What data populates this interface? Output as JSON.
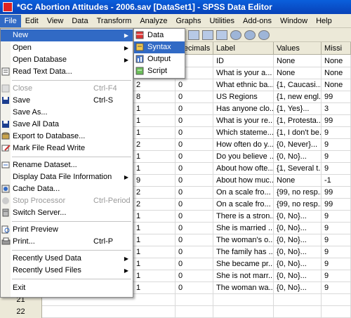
{
  "window": {
    "title": "*GC Abortion Attitudes - 2006.sav [DataSet1] - SPSS Data Editor"
  },
  "menubar": [
    "File",
    "Edit",
    "View",
    "Data",
    "Transform",
    "Analyze",
    "Graphs",
    "Utilities",
    "Add-ons",
    "Window",
    "Help"
  ],
  "columns": {
    "decimals": "Decimals",
    "label": "Label",
    "values": "Values",
    "missing": "Missi"
  },
  "rows": [
    {
      "num": "",
      "dec": "",
      "width": "",
      "label": "ID",
      "values": "None",
      "missing": "None"
    },
    {
      "num": "",
      "dec": "0",
      "width": "2",
      "label": "What is your a...",
      "values": "None",
      "missing": "None"
    },
    {
      "num": "",
      "dec": "0",
      "width": "2",
      "label": "What ethnic ba...",
      "values": "{1, Caucasi...",
      "missing": "None"
    },
    {
      "num": "",
      "dec": "0",
      "width": "8",
      "label": "US Regions",
      "values": "{1, new engl...",
      "missing": "99"
    },
    {
      "num": "",
      "dec": "0",
      "width": "1",
      "label": "Has anyone clo...",
      "values": "{1, Yes}...",
      "missing": "3"
    },
    {
      "num": "",
      "dec": "0",
      "width": "1",
      "label": "What is your re...",
      "values": "{1, Protesta...",
      "missing": "99"
    },
    {
      "num": "",
      "dec": "0",
      "width": "1",
      "label": "Which stateme...",
      "values": "{1, I don't be...",
      "missing": "9"
    },
    {
      "num": "",
      "dec": "0",
      "width": "2",
      "label": "How often do y...",
      "values": "{0, Never}...",
      "missing": "9"
    },
    {
      "num": "",
      "dec": "0",
      "width": "1",
      "label": "Do you believe ...",
      "values": "{0, No}...",
      "missing": "9"
    },
    {
      "num": "",
      "dec": "0",
      "width": "1",
      "label": "About how ofte...",
      "values": "{1, Several t...",
      "missing": "9"
    },
    {
      "num": "",
      "dec": "0",
      "width": "9",
      "label": "About how muc...",
      "values": "None",
      "missing": "-1"
    },
    {
      "num": "",
      "dec": "0",
      "width": "2",
      "label": "On a scale fro...",
      "values": "{99, no resp...",
      "missing": "99"
    },
    {
      "num": "",
      "dec": "0",
      "width": "2",
      "label": "On a scale fro...",
      "values": "{99, no resp...",
      "missing": "99"
    },
    {
      "num": "",
      "dec": "0",
      "width": "1",
      "label": "There is a stron...",
      "values": "{0, No}...",
      "missing": "9"
    },
    {
      "num": "",
      "dec": "0",
      "width": "1",
      "label": "She is married ...",
      "values": "{0, No}...",
      "missing": "9"
    },
    {
      "num": "",
      "dec": "0",
      "width": "1",
      "label": "The woman's o...",
      "values": "{0, No}...",
      "missing": "9"
    },
    {
      "num": "",
      "dec": "0",
      "width": "1",
      "label": "The family has ...",
      "values": "{0, No}...",
      "missing": "9"
    },
    {
      "num": "",
      "dec": "0",
      "width": "1",
      "label": "She became pr...",
      "values": "{0, No}...",
      "missing": "9"
    },
    {
      "num": "",
      "dec": "0",
      "width": "1",
      "label": "She is not marr...",
      "values": "{0, No}...",
      "missing": "9"
    },
    {
      "num": "",
      "dec": "0",
      "width": "1",
      "label": "The woman wa...",
      "values": "{0, No}...",
      "missing": "9"
    },
    {
      "num": "21",
      "dec": "",
      "width": "",
      "label": "",
      "values": "",
      "missing": ""
    },
    {
      "num": "22",
      "dec": "",
      "width": "",
      "label": "",
      "values": "",
      "missing": ""
    }
  ],
  "file_menu": {
    "new": "New",
    "open": "Open",
    "open_database": "Open Database",
    "read_text": "Read Text Data...",
    "close": "Close",
    "close_sc": "Ctrl-F4",
    "save": "Save",
    "save_sc": "Ctrl-S",
    "save_as": "Save As...",
    "save_all": "Save All Data",
    "export_db": "Export to Database...",
    "mark_read": "Mark File Read Write",
    "rename": "Rename Dataset...",
    "display_info": "Display Data File Information",
    "cache": "Cache Data...",
    "stop": "Stop Processor",
    "stop_sc": "Ctrl-Period",
    "switch_server": "Switch Server...",
    "print_preview": "Print Preview",
    "print": "Print...",
    "print_sc": "Ctrl-P",
    "recent_data": "Recently Used Data",
    "recent_files": "Recently Used Files",
    "exit": "Exit"
  },
  "new_submenu": {
    "data": "Data",
    "syntax": "Syntax",
    "output": "Output",
    "script": "Script"
  },
  "colors": {
    "highlight": "#316ac5",
    "titlebar": "#0a5fdc",
    "menubar": "#ece9d8"
  }
}
